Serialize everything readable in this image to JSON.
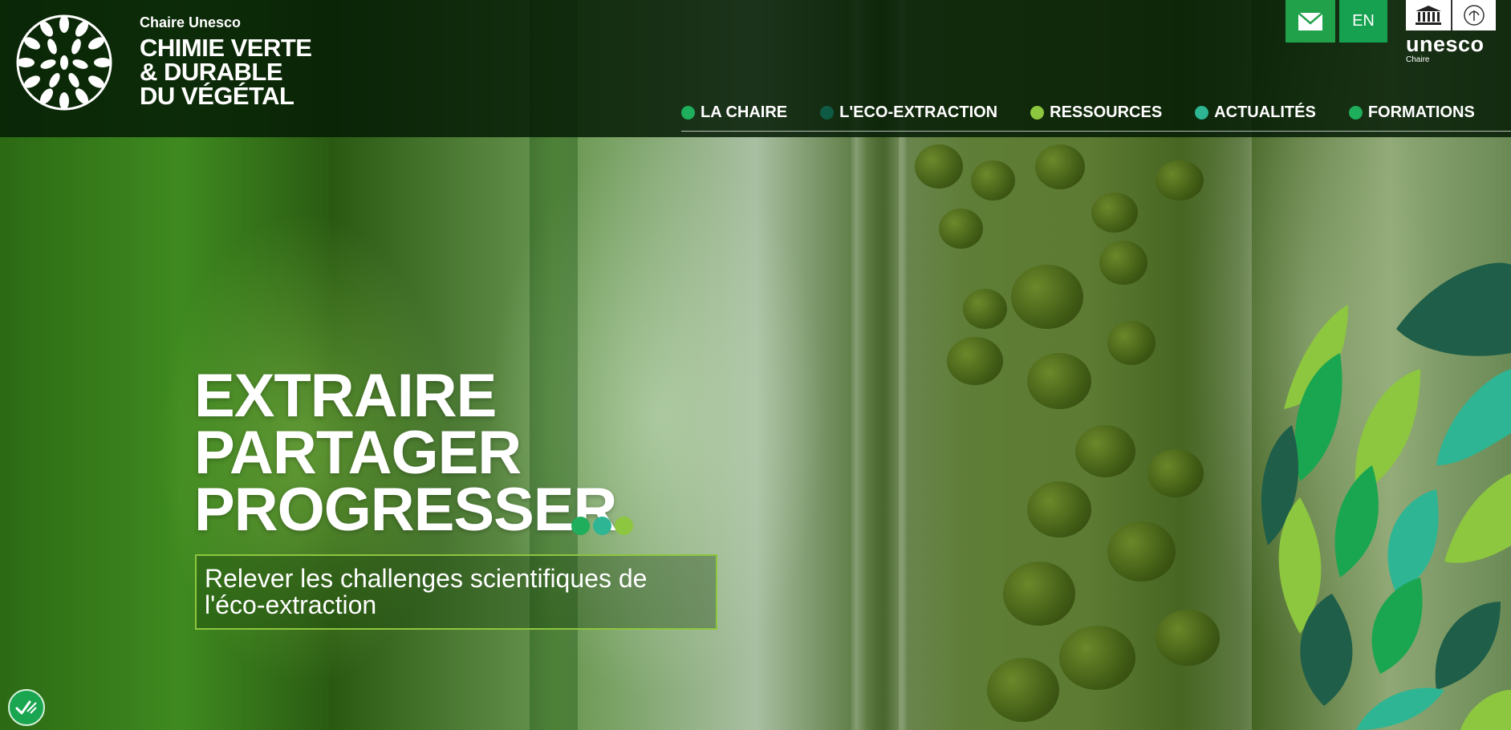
{
  "logo": {
    "small": "Chaire Unesco",
    "line1": "CHIMIE VERTE",
    "line2": "& DURABLE",
    "line3": "DU VÉGÉTAL"
  },
  "header": {
    "mail_icon": "envelope-icon",
    "lang_label": "EN",
    "unesco_word": "unesco",
    "unesco_sub": "Chaire"
  },
  "nav": {
    "items": [
      {
        "label": "LA CHAIRE",
        "color": "#1fae5b"
      },
      {
        "label": "L'ECO-EXTRACTION",
        "color": "#0f5a44"
      },
      {
        "label": "RESSOURCES",
        "color": "#8dc63f"
      },
      {
        "label": "ACTUALITÉS",
        "color": "#2db594"
      },
      {
        "label": "FORMATIONS",
        "color": "#1fae5b"
      }
    ]
  },
  "hero": {
    "line1": "EXTRAIRE",
    "line2": "PARTAGER",
    "line3": "PROGRESSER",
    "tagline": "Relever les challenges scientifiques de l'éco-extraction",
    "dot_colors": [
      "#1fae5b",
      "#2db594",
      "#8dc63f"
    ]
  },
  "accessibility": {
    "icon": "accessibility-check-icon"
  }
}
